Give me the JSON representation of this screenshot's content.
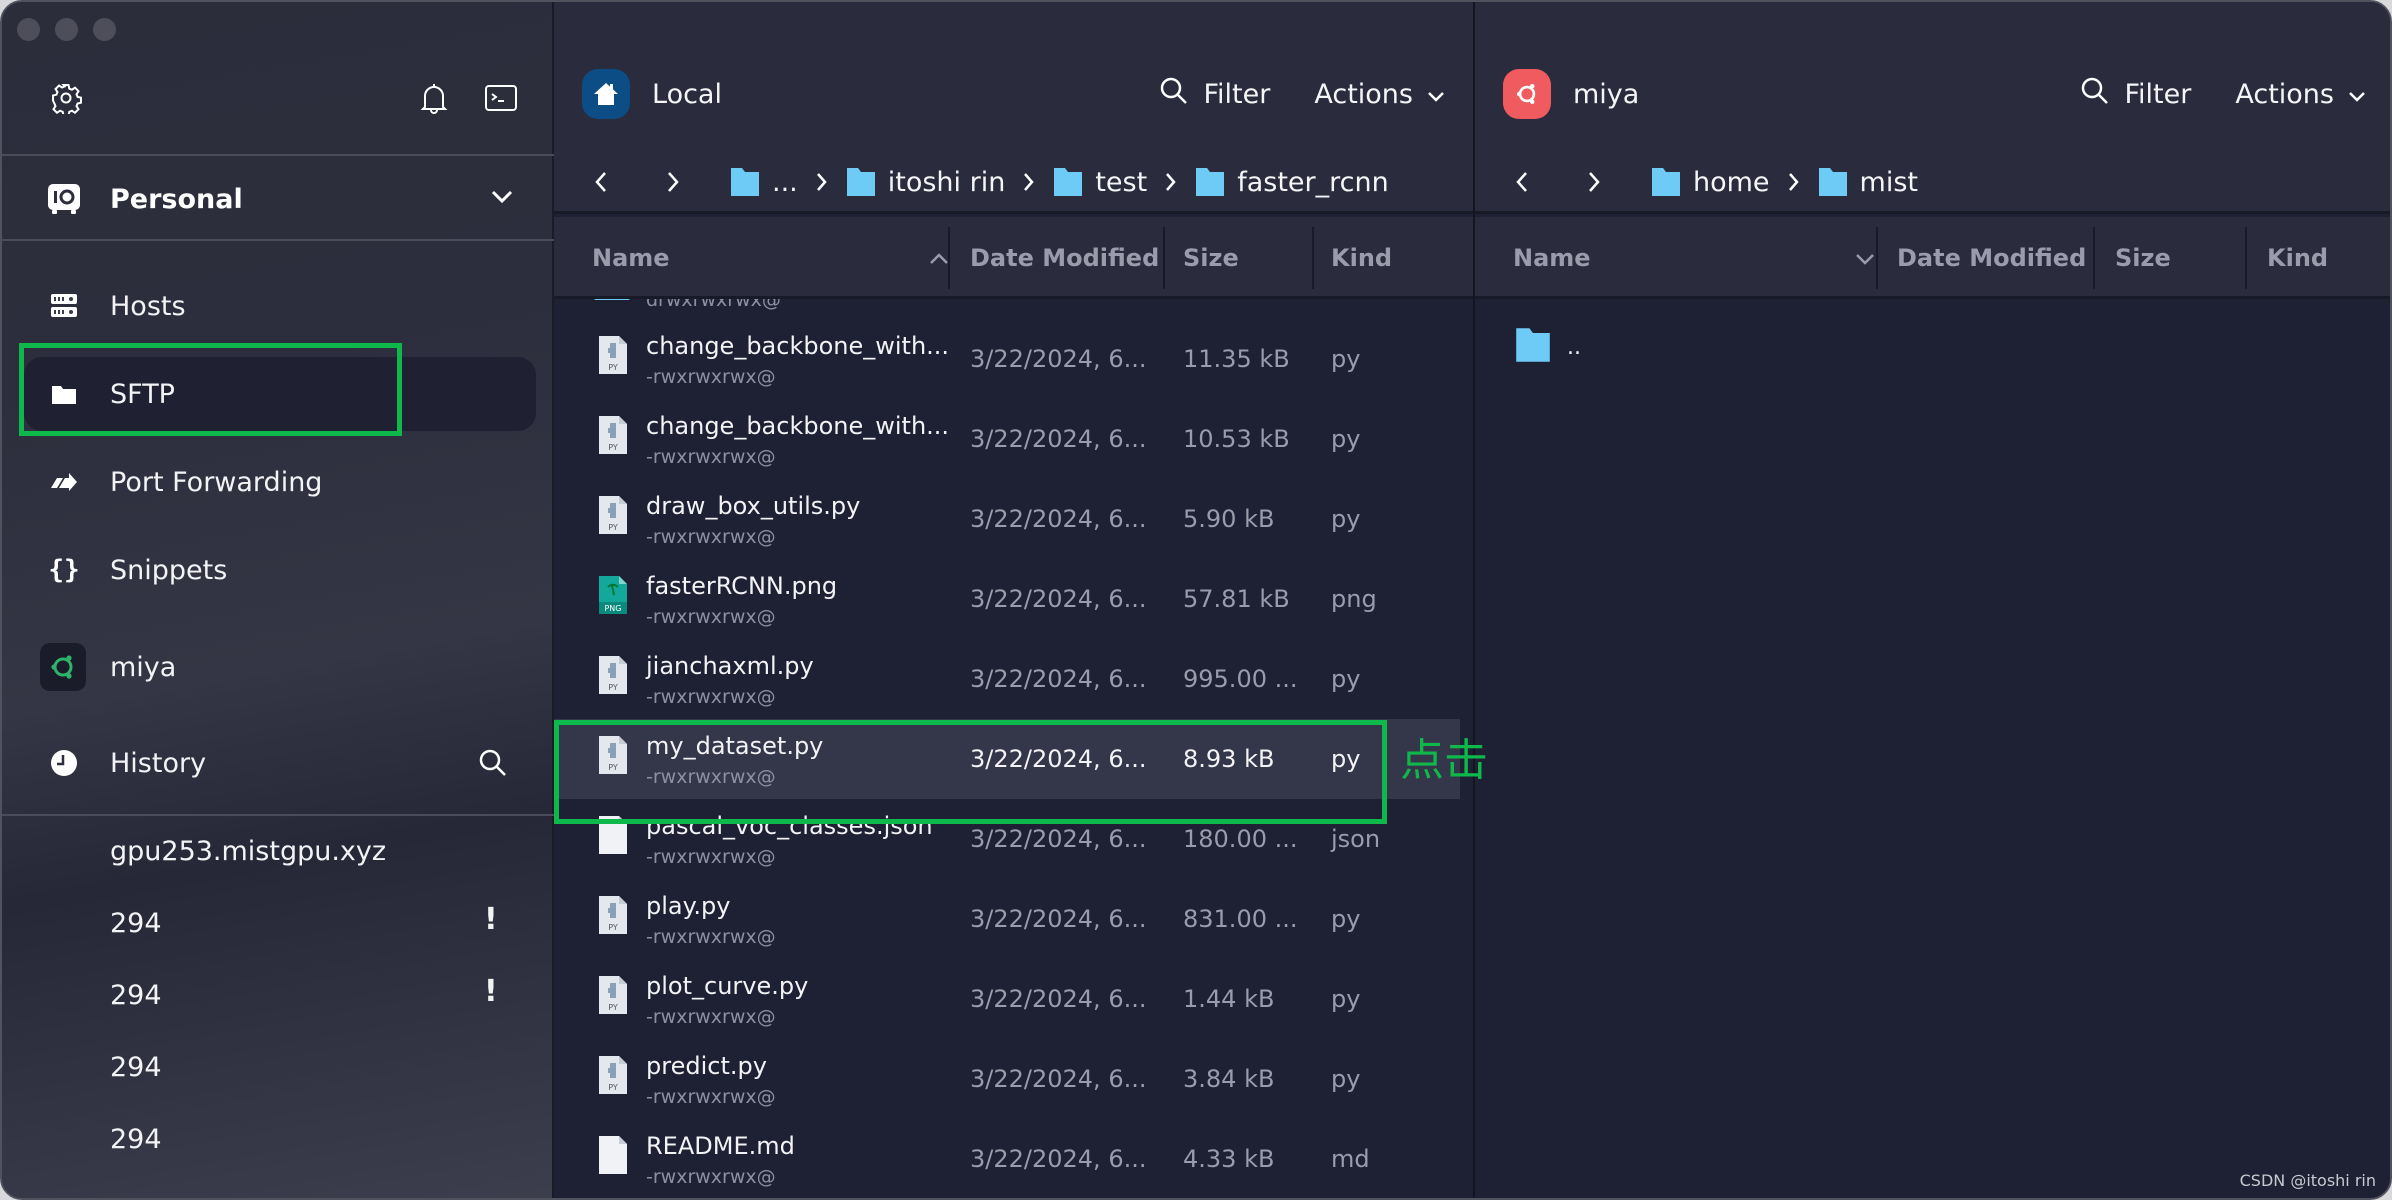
{
  "sidebar": {
    "top_icons": {
      "settings": "gear-icon",
      "notifications": "bell-icon",
      "terminal": "terminal-icon"
    },
    "vault": {
      "label": "Personal",
      "icon": "vault-icon"
    },
    "nav": [
      {
        "label": "Hosts",
        "icon": "hosts-icon"
      },
      {
        "label": "SFTP",
        "icon": "folder-icon",
        "active": true
      },
      {
        "label": "Port Forwarding",
        "icon": "port-forward-icon"
      },
      {
        "label": "Snippets",
        "icon": "braces-icon"
      },
      {
        "label": "miya",
        "icon": "ubuntu-icon"
      }
    ],
    "history": {
      "label": "History",
      "items": [
        {
          "label": "gpu253.mistgpu.xyz",
          "warning": false
        },
        {
          "label": "294",
          "warning": true,
          "warning_glyph": "!"
        },
        {
          "label": "294",
          "warning": true,
          "warning_glyph": "!"
        },
        {
          "label": "294",
          "warning": false
        },
        {
          "label": "294",
          "warning": false
        }
      ]
    }
  },
  "local": {
    "title": "Local",
    "badge_color": "#0d4d86",
    "filter_label": "Filter",
    "actions_label": "Actions",
    "breadcrumb": [
      "...",
      "itoshi rin",
      "test",
      "faster_rcnn"
    ],
    "columns": {
      "name": "Name",
      "date": "Date Modified",
      "size": "Size",
      "kind": "Kind",
      "sort": "ascending"
    },
    "partial_row": {
      "perm": "drwxrwxrwx@"
    },
    "files": [
      {
        "name": "change_backbone_with...",
        "perm": "-rwxrwxrwx@",
        "date": "3/22/2024, 6...",
        "size": "11.35 kB",
        "kind": "py",
        "type": "py"
      },
      {
        "name": "change_backbone_with...",
        "perm": "-rwxrwxrwx@",
        "date": "3/22/2024, 6...",
        "size": "10.53 kB",
        "kind": "py",
        "type": "py"
      },
      {
        "name": "draw_box_utils.py",
        "perm": "-rwxrwxrwx@",
        "date": "3/22/2024, 6...",
        "size": "5.90 kB",
        "kind": "py",
        "type": "py"
      },
      {
        "name": "fasterRCNN.png",
        "perm": "-rwxrwxrwx@",
        "date": "3/22/2024, 6...",
        "size": "57.81 kB",
        "kind": "png",
        "type": "png"
      },
      {
        "name": "jianchaxml.py",
        "perm": "-rwxrwxrwx@",
        "date": "3/22/2024, 6...",
        "size": "995.00 ...",
        "kind": "py",
        "type": "py"
      },
      {
        "name": "my_dataset.py",
        "perm": "-rwxrwxrwx@",
        "date": "3/22/2024, 6...",
        "size": "8.93 kB",
        "kind": "py",
        "type": "py",
        "selected": true
      },
      {
        "name": "pascal_voc_classes.json",
        "perm": "-rwxrwxrwx@",
        "date": "3/22/2024, 6...",
        "size": "180.00 ...",
        "kind": "json",
        "type": "doc"
      },
      {
        "name": "play.py",
        "perm": "-rwxrwxrwx@",
        "date": "3/22/2024, 6...",
        "size": "831.00 ...",
        "kind": "py",
        "type": "py"
      },
      {
        "name": "plot_curve.py",
        "perm": "-rwxrwxrwx@",
        "date": "3/22/2024, 6...",
        "size": "1.44 kB",
        "kind": "py",
        "type": "py"
      },
      {
        "name": "predict.py",
        "perm": "-rwxrwxrwx@",
        "date": "3/22/2024, 6...",
        "size": "3.84 kB",
        "kind": "py",
        "type": "py"
      },
      {
        "name": "README.md",
        "perm": "-rwxrwxrwx@",
        "date": "3/22/2024, 6...",
        "size": "4.33 kB",
        "kind": "md",
        "type": "doc"
      }
    ]
  },
  "remote": {
    "title": "miya",
    "badge_color": "#ef5b5e",
    "filter_label": "Filter",
    "actions_label": "Actions",
    "breadcrumb": [
      "home",
      "mist"
    ],
    "columns": {
      "name": "Name",
      "date": "Date Modified",
      "size": "Size",
      "kind": "Kind",
      "sort": "descending"
    },
    "files": [
      {
        "name": "..",
        "type": "folder"
      }
    ]
  },
  "annotation": {
    "text": "点击",
    "color": "#0fb84a"
  },
  "watermark": "CSDN @itoshi rin",
  "colors": {
    "folder": "#6ecbf5",
    "accent_green": "#0fb84a",
    "ubuntu_green": "#2fb36a"
  }
}
